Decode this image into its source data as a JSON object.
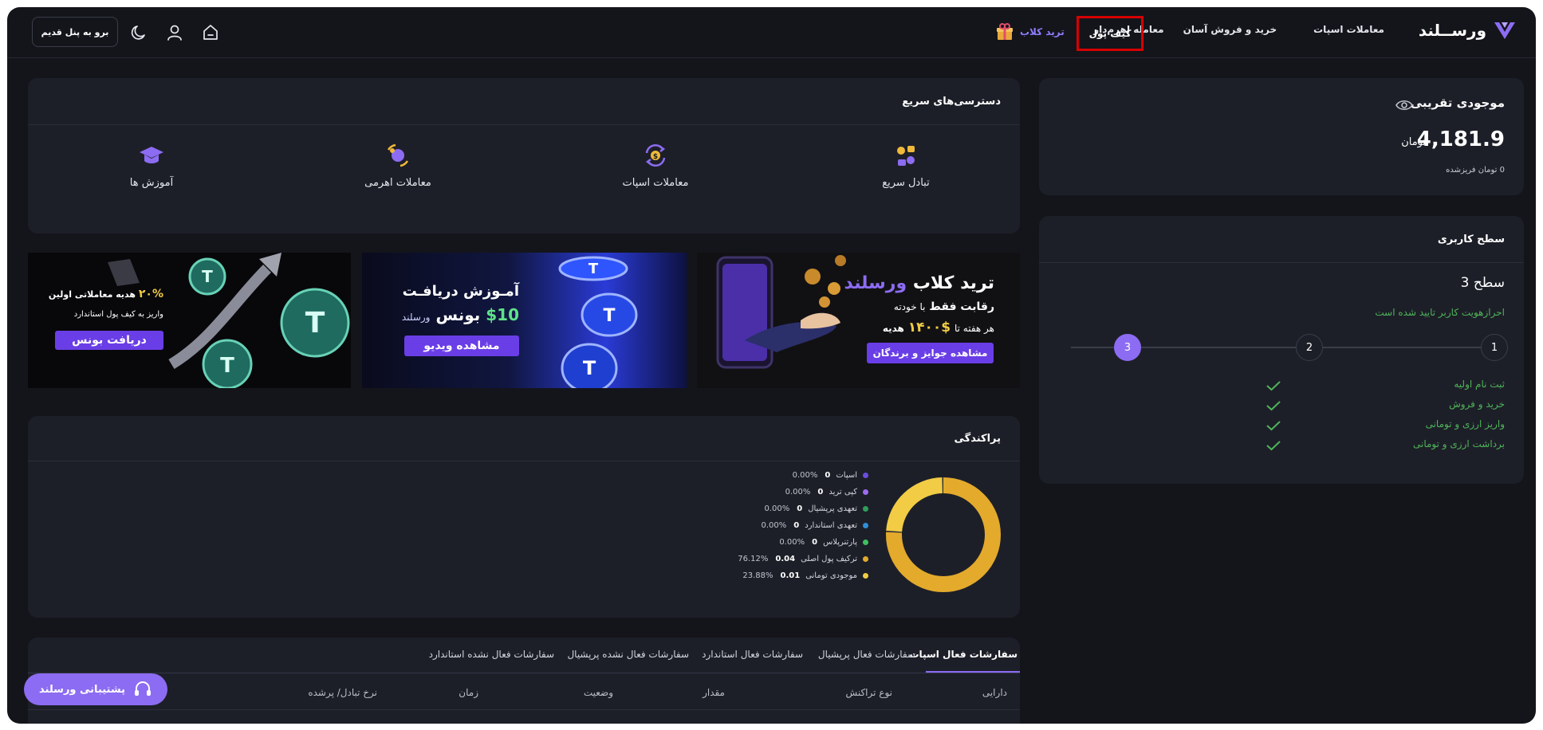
{
  "nav": {
    "brand": "ورســلند",
    "menu": [
      "معاملات اسپات",
      "خرید و فروش آسان",
      "معامله اهرم‌دار",
      "کیف پول"
    ],
    "trade_club": "ترید کلاب",
    "old_panel": "برو به پنل قدیم"
  },
  "balance": {
    "label": "موجودی تقریبی",
    "amount": "4,181.9",
    "unit": "تومان",
    "frozen": "0 تومان فریزشده"
  },
  "level": {
    "title": "سطح کاربری",
    "level_name": "سطح 3",
    "kyc": "احرازهویت کاربر تایید شده است",
    "steps": [
      "1",
      "2",
      "3"
    ],
    "requirements": [
      "ثبت نام اولیه",
      "خرید و فروش",
      "واریز ارزی و تومانی",
      "برداشت ارزی و تومانی"
    ]
  },
  "quick_access": {
    "title": "دسترسی‌های سریع",
    "items": [
      "تبادل سریع",
      "معاملات اسپات",
      "معاملات اهرمی",
      "آموزش ها"
    ]
  },
  "banners": {
    "club": {
      "title_prefix": "ترید کلاب",
      "title_brand": "ورسلند",
      "line1": "رقابت فقط",
      "line1_b": "با خودته",
      "line2": "هر هفته تا",
      "prize": "$۱۴۰۰",
      "line2_b": "هدیه",
      "button": "مشاهده جوایز و برندگان"
    },
    "tutorial": {
      "title": "آمـوزش دریافـت",
      "amount": "$10",
      "bonus": "بونس",
      "brand": "ورسلند",
      "button": "مشاهده ویدیو"
    },
    "bonus": {
      "percent": "۲۰%",
      "title": "هدیه معاملاتی اولین",
      "line2": "واریز به کیف پول استاندارد",
      "button": "دریافت بونس"
    }
  },
  "distribution": {
    "title": "پراکندگی",
    "items": [
      {
        "name": "اسپات",
        "value": "0",
        "percent": "0.00%",
        "color": "#6a4ee0"
      },
      {
        "name": "کپی ترید",
        "value": "0",
        "percent": "0.00%",
        "color": "#9c6cf0"
      },
      {
        "name": "تعهدی پرپشیال",
        "value": "0",
        "percent": "0.00%",
        "color": "#2f9e5b"
      },
      {
        "name": "تعهدی استاندارد",
        "value": "0",
        "percent": "0.00%",
        "color": "#2f8fd6"
      },
      {
        "name": "پارتنرپلاس",
        "value": "0",
        "percent": "0.00%",
        "color": "#3fbf5f"
      },
      {
        "name": "ترکیف پول اصلی",
        "value": "0.04",
        "percent": "76.12%",
        "color": "#e3aa2c"
      },
      {
        "name": "موجودی تومانی",
        "value": "0.01",
        "percent": "23.88%",
        "color": "#f2cc44"
      }
    ],
    "chart_data": {
      "type": "pie",
      "categories": [
        "اسپات",
        "کپی ترید",
        "تعهدی پرپشیال",
        "تعهدی استاندارد",
        "پارتنرپلاس",
        "ترکیف پول اصلی",
        "موجودی تومانی"
      ],
      "values": [
        0,
        0,
        0,
        0,
        0,
        76.12,
        23.88
      ]
    }
  },
  "orders": {
    "tabs": [
      "سفارشات فعال اسپات",
      "سفارشات فعال پرپشیال",
      "سفارشات فعال استاندارد",
      "سفارشات فعال نشده پرپشیال",
      "سفارشات فعال نشده استاندارد"
    ],
    "columns": [
      "دارایی",
      "نوع تراکنش",
      "مقدار",
      "وضعیت",
      "زمان",
      "نرخ تبادل/ پرشده"
    ]
  },
  "support": "پشتیبانی ورسلند"
}
